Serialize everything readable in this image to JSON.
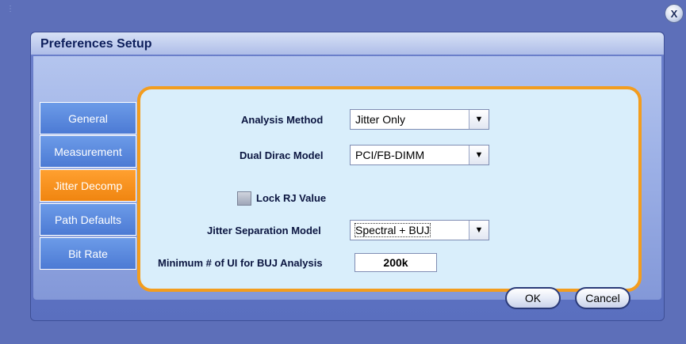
{
  "window": {
    "close_label": "X"
  },
  "dialog": {
    "title": "Preferences Setup"
  },
  "tabs": [
    {
      "label": "General",
      "active": false
    },
    {
      "label": "Measurement",
      "active": false
    },
    {
      "label": "Jitter Decomp",
      "active": true
    },
    {
      "label": "Path Defaults",
      "active": false
    },
    {
      "label": "Bit Rate",
      "active": false
    }
  ],
  "form": {
    "analysis_method": {
      "label": "Analysis Method",
      "value": "Jitter Only"
    },
    "dual_dirac_model": {
      "label": "Dual Dirac Model",
      "value": "PCI/FB-DIMM"
    },
    "lock_rj": {
      "label": "Lock RJ Value",
      "checked": false
    },
    "jitter_separation_model": {
      "label": "Jitter Separation Model",
      "value": "Spectral + BUJ"
    },
    "min_ui_buj": {
      "label": "Minimum # of UI for BUJ Analysis",
      "value": "200k"
    }
  },
  "buttons": {
    "ok": "OK",
    "cancel": "Cancel"
  },
  "icons": {
    "dropdown_arrow": "▼"
  },
  "colors": {
    "active_tab": "#f08510",
    "tab": "#4c7ad4",
    "panel_border": "#f39d1e",
    "panel_bg": "#d9eefb"
  }
}
